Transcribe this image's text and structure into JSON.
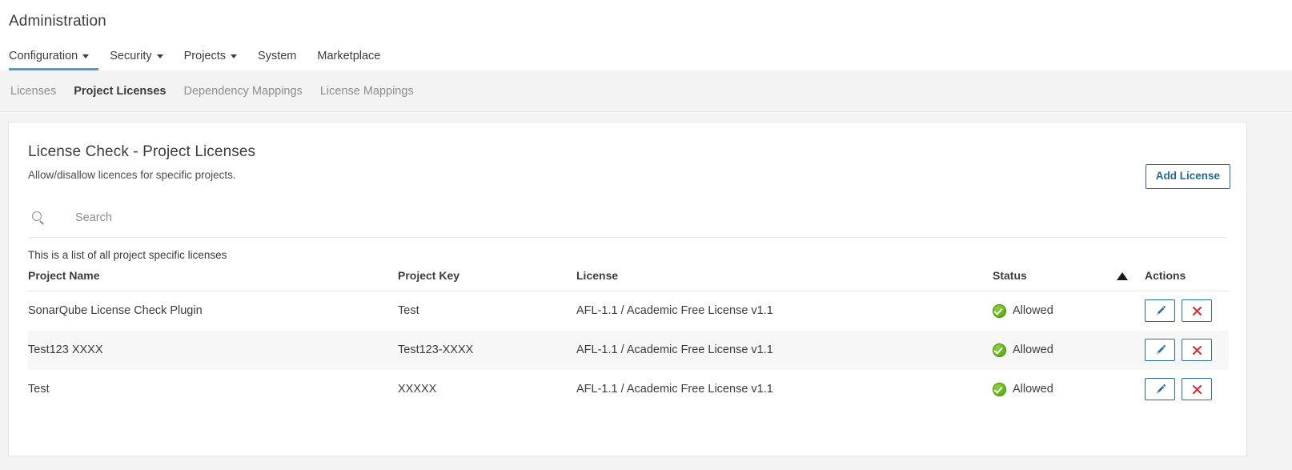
{
  "header": {
    "title": "Administration",
    "main_nav": [
      {
        "label": "Configuration",
        "has_caret": true,
        "active": true
      },
      {
        "label": "Security",
        "has_caret": true,
        "active": false
      },
      {
        "label": "Projects",
        "has_caret": true,
        "active": false
      },
      {
        "label": "System",
        "has_caret": false,
        "active": false
      },
      {
        "label": "Marketplace",
        "has_caret": false,
        "active": false
      }
    ],
    "sub_nav": [
      {
        "label": "Licenses",
        "active": false
      },
      {
        "label": "Project Licenses",
        "active": true
      },
      {
        "label": "Dependency Mappings",
        "active": false
      },
      {
        "label": "License Mappings",
        "active": false
      }
    ]
  },
  "card": {
    "title": "License Check - Project Licenses",
    "subtitle": "Allow/disallow licences for specific projects.",
    "add_button": "Add License",
    "search": {
      "icon": "search-icon",
      "value": "",
      "placeholder": "Search"
    },
    "list_note": "This is a list of all project specific licenses",
    "columns": {
      "name": "Project Name",
      "key": "Project Key",
      "license": "License",
      "status": "Status",
      "actions": "Actions",
      "sort_indicator": "sort-ascending-icon"
    },
    "rows": [
      {
        "project_name": "SonarQube License Check Plugin",
        "project_key": "Test",
        "license": "AFL-1.1 / Academic Free License v1.1",
        "status": "Allowed",
        "status_icon": "check-circle-icon",
        "edit_icon": "pencil-icon",
        "delete_icon": "close-x-icon"
      },
      {
        "project_name": "Test123 XXXX",
        "project_key": "Test123-XXXX",
        "license": "AFL-1.1 / Academic Free License v1.1",
        "status": "Allowed",
        "status_icon": "check-circle-icon",
        "edit_icon": "pencil-icon",
        "delete_icon": "close-x-icon"
      },
      {
        "project_name": "Test",
        "project_key": "XXXXX",
        "license": "AFL-1.1 / Academic Free License v1.1",
        "status": "Allowed",
        "status_icon": "check-circle-icon",
        "edit_icon": "pencil-icon",
        "delete_icon": "close-x-icon"
      }
    ]
  },
  "colors": {
    "accent_blue": "#4b9fd5",
    "link_blue": "#236a97",
    "status_green": "#63b41c",
    "delete_red": "#d0323a",
    "text": "#3c3c3c",
    "muted_text": "#8d8d8d",
    "page_bg": "#f3f3f3",
    "stripe_bg": "#f7f7f7"
  }
}
